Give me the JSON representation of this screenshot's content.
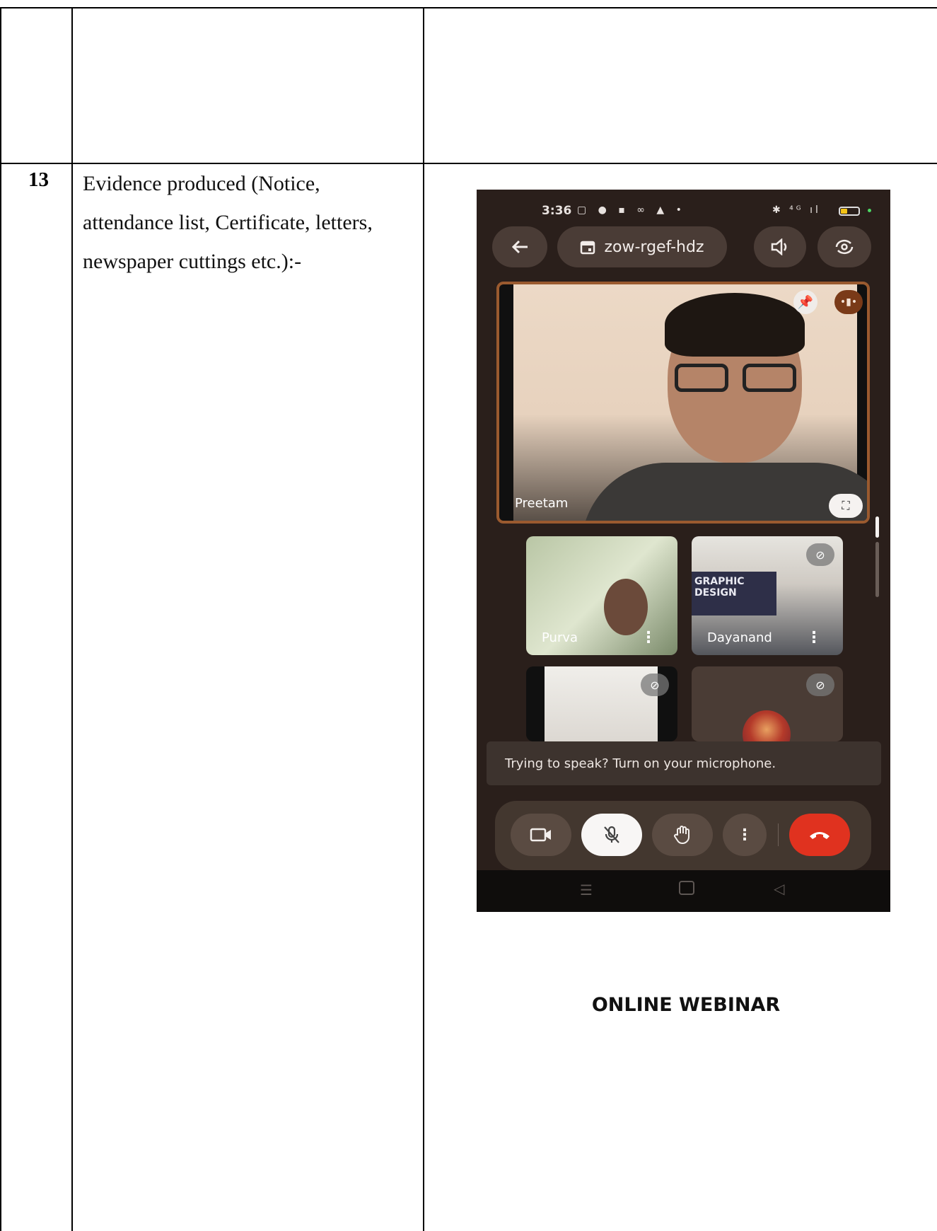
{
  "row": {
    "number": "13",
    "text": "Evidence produced (Notice, attendance list, Certificate, letters, newspaper cuttings etc.):-"
  },
  "phone": {
    "status_time": "3:36",
    "status_left_icons": "▢ ● ▪ ∞ ▲ •",
    "status_right_icons": "✱ ⁴ᴳ ıl",
    "meeting_code": "zow-rgef-hdz",
    "main_participant": "Preetam",
    "participants": [
      "Purva",
      "Dayanand"
    ],
    "poster_text": "GRAPHIC DESIGN",
    "toast": "Trying to speak? Turn on your microphone.",
    "icons": {
      "back": "arrow-left-icon",
      "calendar": "calendar-icon",
      "speaker": "speaker-icon",
      "flip": "camera-flip-icon",
      "pin": "pin-icon",
      "audio": "audio-level-icon",
      "fullscreen": "fullscreen-icon",
      "mute": "mic-off-icon",
      "camera": "video-camera-icon",
      "hand": "raise-hand-icon",
      "more": "more-vert-icon",
      "end": "end-call-icon"
    },
    "colors": {
      "end_call": "#e0321f",
      "tile_border": "#9a5a2f"
    }
  },
  "caption": "ONLINE WEBINAR"
}
